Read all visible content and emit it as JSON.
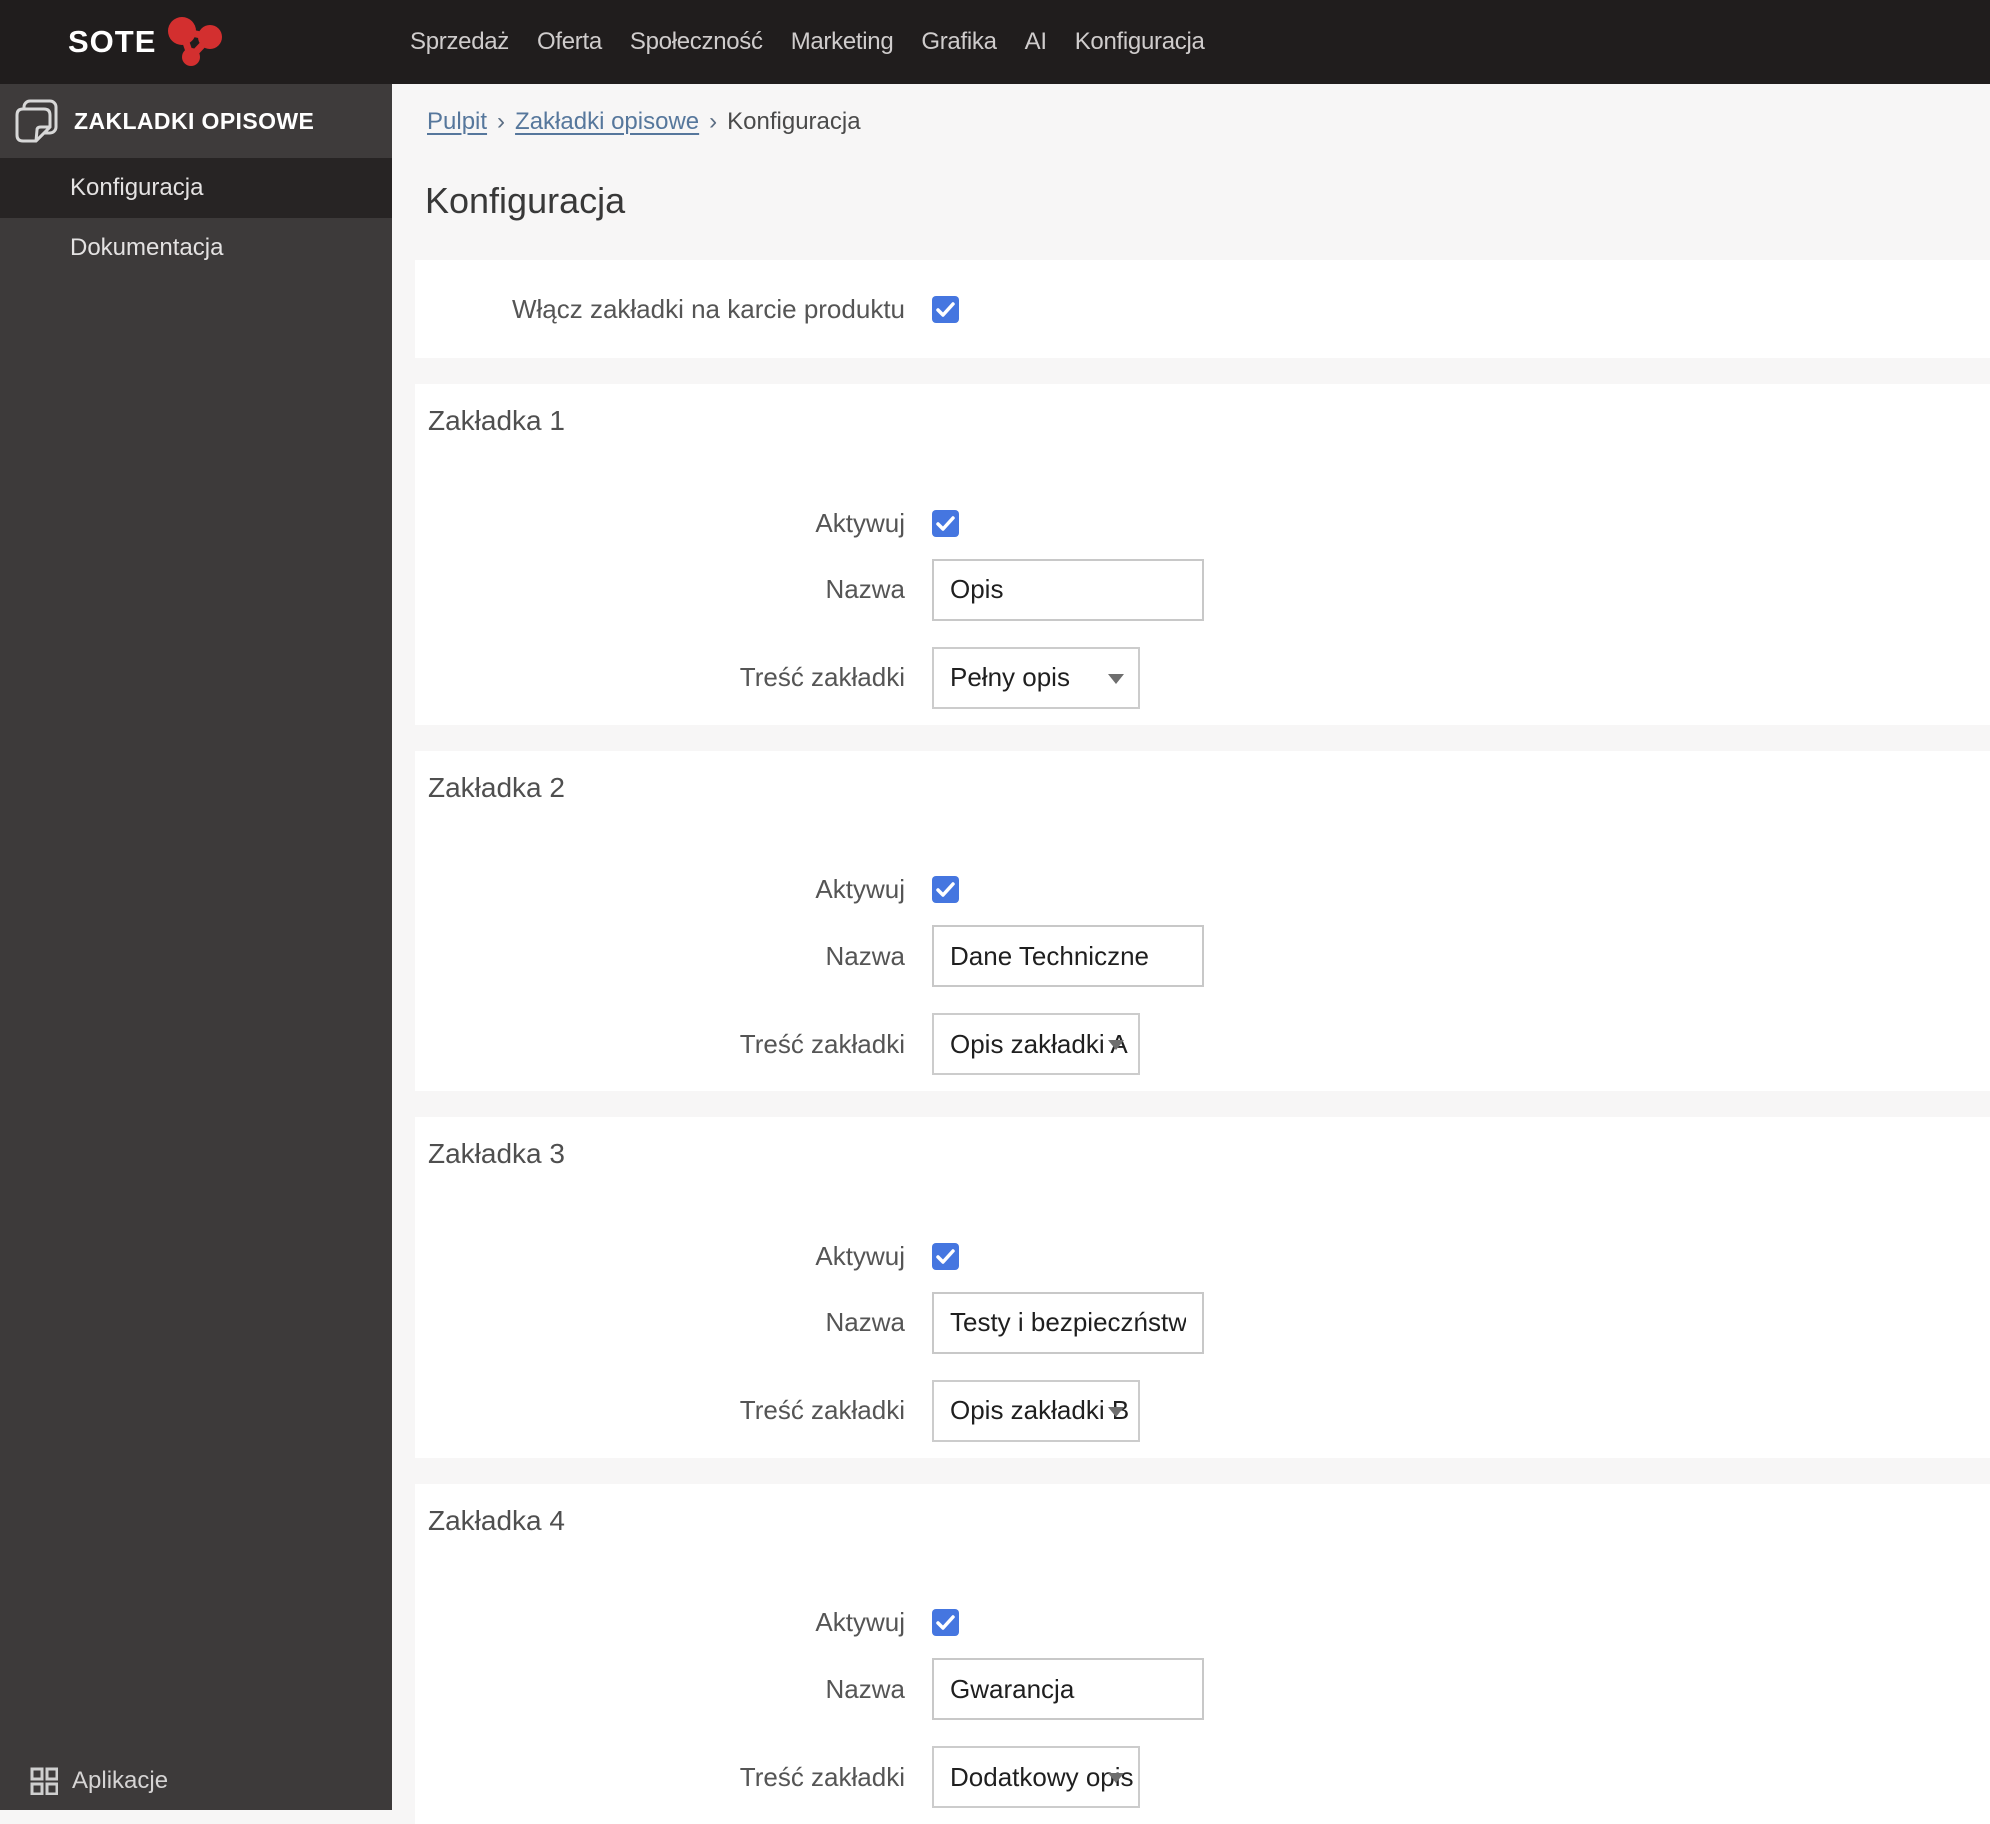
{
  "navbar": {
    "logo": "SOTE",
    "items": [
      {
        "label": "Sprzedaż"
      },
      {
        "label": "Oferta"
      },
      {
        "label": "Społeczność"
      },
      {
        "label": "Marketing"
      },
      {
        "label": "Grafika"
      },
      {
        "label": "AI"
      },
      {
        "label": "Konfiguracja"
      }
    ]
  },
  "sidebar": {
    "title": "ZAKLADKI OPISOWE",
    "items": [
      {
        "label": "Konfiguracja",
        "active": true
      },
      {
        "label": "Dokumentacja",
        "active": false
      }
    ],
    "footer_label": "Aplikacje"
  },
  "breadcrumb": {
    "separator": "›",
    "links": [
      {
        "label": "Pulpit"
      },
      {
        "label": "Zakładki opisowe"
      }
    ],
    "current": "Konfiguracja"
  },
  "page": {
    "title": "Konfiguracja"
  },
  "master": {
    "label": "Włącz zakładki na karcie produktu",
    "checked": true
  },
  "form_labels": {
    "active": "Aktywuj",
    "name": "Nazwa",
    "content": "Treść zakładki"
  },
  "tabs": [
    {
      "heading": "Zakładka 1",
      "active_checked": true,
      "name": "Opis",
      "content": "Pełny opis"
    },
    {
      "heading": "Zakładka 2",
      "active_checked": true,
      "name": "Dane Techniczne",
      "content": "Opis zakładki A"
    },
    {
      "heading": "Zakładka 3",
      "active_checked": true,
      "name": "Testy i bezpieczństwo",
      "content": "Opis zakładki B"
    },
    {
      "heading": "Zakładka 4",
      "active_checked": true,
      "name": "Gwarancja",
      "content": "Dodatkowy opis"
    }
  ],
  "colors": {
    "navbar_bg": "#201d1d",
    "sidebar_bg": "#3d3a3a",
    "sidebar_active_bg": "#272424",
    "checkbox_blue": "#4576e0",
    "logo_red": "#d32f2f",
    "link_blue": "#56779c",
    "main_bg": "#f7f6f6"
  }
}
